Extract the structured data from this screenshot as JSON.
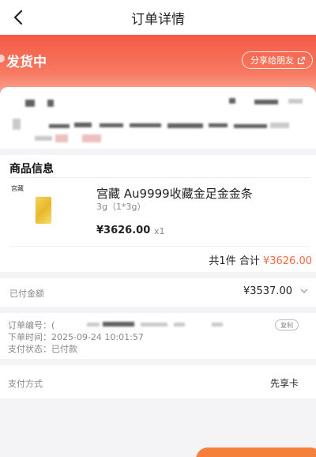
{
  "nav": {
    "title": "订单详情",
    "back_icon": "chevron-left-icon"
  },
  "status": {
    "text": "发货中",
    "share_label": "分享给朋友",
    "share_icon": "share-arrow-icon"
  },
  "goods": {
    "section_title": "商品信息",
    "thumb_brand": "宫藏",
    "name": "宫藏 Au9999收藏金足金金条",
    "spec": "3g（1*3g）",
    "price": "¥3626.00",
    "qty": "x1",
    "total_prefix": "共1件 合计 ",
    "total_amount": "¥3626.00"
  },
  "payment": {
    "paid_label": "已付金额",
    "paid_value": "¥3537.00"
  },
  "order_info": {
    "order_no_label": "订单编号：",
    "order_no_value": "(",
    "copy_label": "复制",
    "time_label": "下单时间：",
    "time_value": "2025-09-24 10:01:57",
    "pay_status_label": "支付状态：",
    "pay_status_value": "已付款"
  },
  "pay_method": {
    "label": "支付方式",
    "value": "先享卡"
  },
  "colors": {
    "accent": "#f06a45",
    "hero_top": "#f45a45",
    "hero_bottom": "#fbb5a3"
  }
}
